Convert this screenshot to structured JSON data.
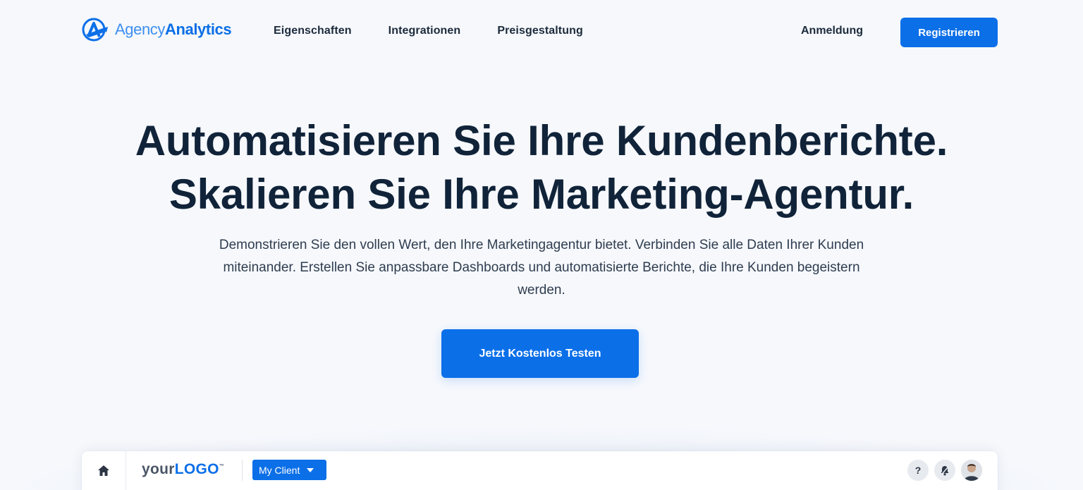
{
  "brand": {
    "name_light": "Agency",
    "name_bold": "Analytics",
    "color": "#0b6fe8"
  },
  "nav": {
    "links": [
      "Eigenschaften",
      "Integrationen",
      "Preisgestaltung"
    ],
    "login_label": "Anmeldung",
    "register_label": "Registrieren"
  },
  "hero": {
    "title_line1": "Automatisieren Sie Ihre Kundenberichte.",
    "title_line2": "Skalieren Sie Ihre Marketing-Agentur.",
    "subtitle": "Demonstrieren Sie den vollen Wert, den Ihre Marketingagentur bietet. Verbinden Sie alle Daten Ihrer Kunden miteinander. Erstellen Sie anpassbare Dashboards und automatisierte Berichte, die Ihre Kunden begeistern werden.",
    "cta_label": "Jetzt Kostenlos Testen"
  },
  "preview": {
    "logo_prefix": "your",
    "logo_bold": "LOGO",
    "logo_tm": "™",
    "client_label": "My Client",
    "help_label": "?",
    "icons": [
      "home-icon",
      "caret-down-icon",
      "help-icon",
      "bell-icon",
      "avatar"
    ]
  }
}
